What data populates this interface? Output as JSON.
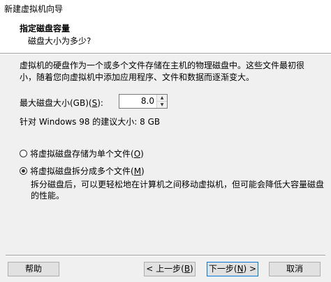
{
  "window": {
    "title": "新建虚拟机向导"
  },
  "header": {
    "title": "指定磁盘容量",
    "subtitle": "磁盘大小为多少?"
  },
  "description": "虚拟机的硬盘作为一个或多个文件存储在主机的物理磁盘中。这些文件最初很小，随着您向虚拟机中添加应用程序、文件和数据而逐渐变大。",
  "disk_size": {
    "label_prefix": "最大磁盘大小(GB)(",
    "label_key": "S",
    "label_suffix": "):",
    "value": "8.0"
  },
  "recommended": "针对 Windows 98 的建议大小: 8 GB",
  "options": [
    {
      "label_prefix": "将虚拟磁盘存储为单个文件(",
      "key": "O",
      "label_suffix": ")",
      "checked": false
    },
    {
      "label_prefix": "将虚拟磁盘拆分成多个文件(",
      "key": "M",
      "label_suffix": ")",
      "checked": true
    }
  ],
  "split_description": "拆分磁盘后，可以更轻松地在计算机之间移动虚拟机，但可能会降低大容量磁盘的性能。",
  "buttons": {
    "help": "帮助",
    "back_prefix": "< 上一步(",
    "back_key": "B",
    "back_suffix": ")",
    "next_prefix": "下一步(",
    "next_key": "N",
    "next_suffix": ") >",
    "cancel": "取消"
  }
}
